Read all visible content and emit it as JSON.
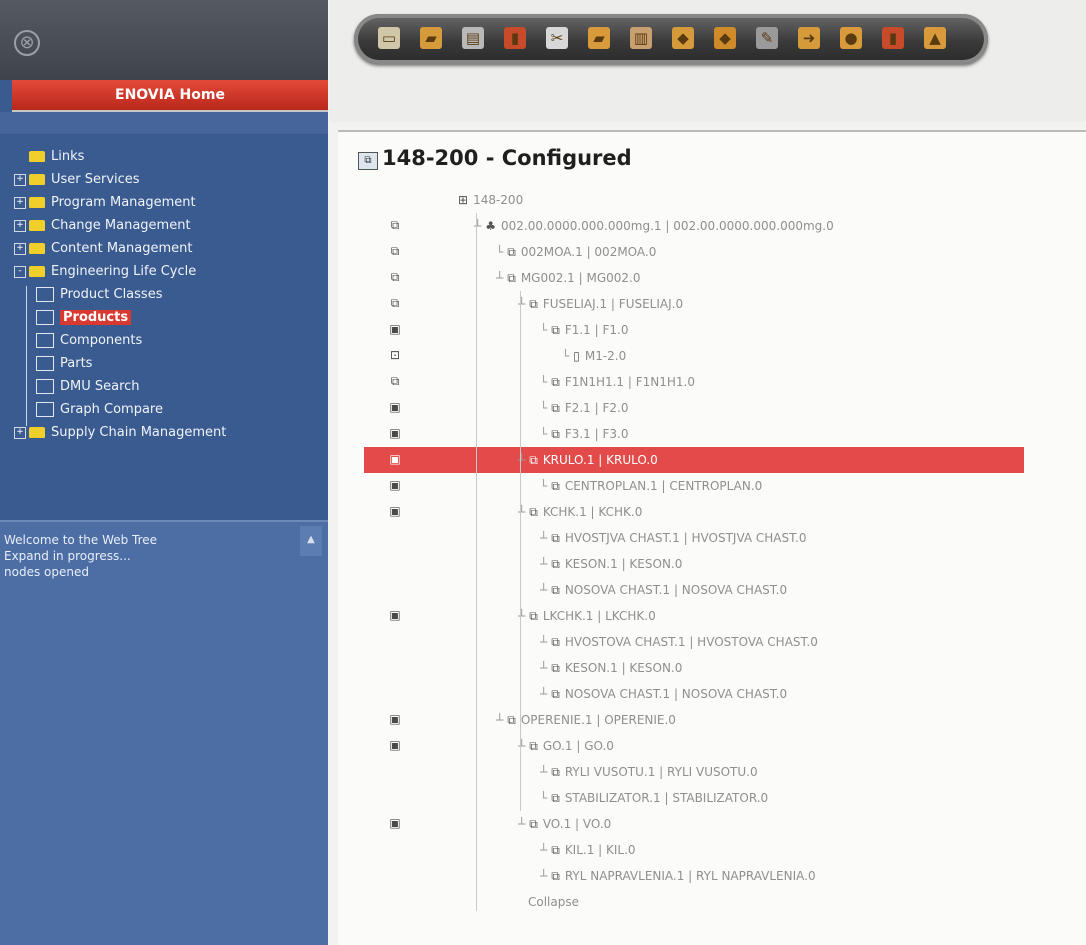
{
  "app": {
    "home_label": "ENOVIA Home"
  },
  "nav": [
    {
      "label": "Links",
      "icon": "folder-icon",
      "expander": "",
      "level": 0
    },
    {
      "label": "User Services",
      "icon": "folder-icon",
      "expander": "+",
      "level": 0
    },
    {
      "label": "Program Management",
      "icon": "folder-icon",
      "expander": "+",
      "level": 0
    },
    {
      "label": "Change Management",
      "icon": "folder-icon",
      "expander": "+",
      "level": 0
    },
    {
      "label": "Content Management",
      "icon": "folder-icon",
      "expander": "+",
      "level": 0
    },
    {
      "label": "Engineering Life Cycle",
      "icon": "folder-icon",
      "expander": "-",
      "level": 0
    },
    {
      "label": "Product Classes",
      "icon": "product-classes-icon",
      "expander": "",
      "level": 1
    },
    {
      "label": "Products",
      "icon": "products-icon",
      "expander": "",
      "level": 1,
      "selected": true
    },
    {
      "label": "Components",
      "icon": "components-icon",
      "expander": "",
      "level": 1
    },
    {
      "label": "Parts",
      "icon": "parts-icon",
      "expander": "",
      "level": 1
    },
    {
      "label": "DMU Search",
      "icon": "dmu-search-icon",
      "expander": "",
      "level": 1
    },
    {
      "label": "Graph Compare",
      "icon": "graph-compare-icon",
      "expander": "",
      "level": 1
    },
    {
      "label": "Supply Chain Management",
      "icon": "folder-icon",
      "expander": "+",
      "level": 0
    }
  ],
  "messages": [
    "Welcome to the Web Tree",
    "Expand in progress...",
    "nodes opened"
  ],
  "toolbar": [
    {
      "name": "new-icon",
      "color": "#cfc7a8"
    },
    {
      "name": "open-folder-icon",
      "color": "#d59a3a"
    },
    {
      "name": "save-icon",
      "color": "#b8b8b8"
    },
    {
      "name": "delete-icon",
      "color": "#c74a2a"
    },
    {
      "name": "cut-icon",
      "color": "#d8d8d8"
    },
    {
      "name": "copy-icon",
      "color": "#d89a3a"
    },
    {
      "name": "paste-icon",
      "color": "#c8a070"
    },
    {
      "name": "expand-icon",
      "color": "#d59a3a"
    },
    {
      "name": "collapse-icon",
      "color": "#cf8a2a"
    },
    {
      "name": "edit-icon",
      "color": "#9a9a9a"
    },
    {
      "name": "forward-icon",
      "color": "#d59a3a"
    },
    {
      "name": "bucket-icon",
      "color": "#d89a3a"
    },
    {
      "name": "doc-export-icon",
      "color": "#c74a2a"
    },
    {
      "name": "lock-icon",
      "color": "#d89a3a"
    }
  ],
  "main": {
    "title": "148-200 - Configured",
    "rows": [
      {
        "text": "148-200",
        "indent": 0,
        "rowicon": "",
        "conn": "",
        "glyph": "⊞"
      },
      {
        "text": "002.00.0000.000.000mg.1 | 002.00.0000.000.000mg.0",
        "indent": 1,
        "rowicon": "⧉",
        "conn": "┴",
        "glyph": "♣"
      },
      {
        "text": "002MOA.1 | 002MOA.0",
        "indent": 2,
        "rowicon": "⧉",
        "conn": "└",
        "glyph": "⧉"
      },
      {
        "text": "MG002.1 | MG002.0",
        "indent": 2,
        "rowicon": "⧉",
        "conn": "┴",
        "glyph": "⧉"
      },
      {
        "text": "FUSELIAJ.1 | FUSELIAJ.0",
        "indent": 3,
        "rowicon": "⧉",
        "conn": "┴",
        "glyph": "⧉"
      },
      {
        "text": "F1.1 | F1.0",
        "indent": 4,
        "rowicon": "▣",
        "conn": "└",
        "glyph": "⧉"
      },
      {
        "text": "M1-2.0",
        "indent": 5,
        "rowicon": "⊡",
        "conn": "└",
        "glyph": "▯"
      },
      {
        "text": "F1N1H1.1 | F1N1H1.0",
        "indent": 4,
        "rowicon": "⧉",
        "conn": "└",
        "glyph": "⧉"
      },
      {
        "text": "F2.1 | F2.0",
        "indent": 4,
        "rowicon": "▣",
        "conn": "└",
        "glyph": "⧉"
      },
      {
        "text": "F3.1 | F3.0",
        "indent": 4,
        "rowicon": "▣",
        "conn": "└",
        "glyph": "⧉"
      },
      {
        "text": "KRULO.1 | KRULO.0",
        "indent": 3,
        "rowicon": "▣",
        "conn": "┴",
        "glyph": "⧉",
        "selected": true
      },
      {
        "text": "CENTROPLAN.1 | CENTROPLAN.0",
        "indent": 4,
        "rowicon": "▣",
        "conn": "└",
        "glyph": "⧉"
      },
      {
        "text": "KCHK.1 | KCHK.0",
        "indent": 3,
        "rowicon": "▣",
        "conn": "┴",
        "glyph": "⧉"
      },
      {
        "text": "HVOSTJVA CHAST.1 | HVOSTJVA CHAST.0",
        "indent": 4,
        "rowicon": "",
        "conn": "┴",
        "glyph": "⧉"
      },
      {
        "text": "KESON.1 | KESON.0",
        "indent": 4,
        "rowicon": "",
        "conn": "┴",
        "glyph": "⧉"
      },
      {
        "text": "NOSOVA CHAST.1 | NOSOVA CHAST.0",
        "indent": 4,
        "rowicon": "",
        "conn": "┴",
        "glyph": "⧉"
      },
      {
        "text": "LKCHK.1 | LKCHK.0",
        "indent": 3,
        "rowicon": "▣",
        "conn": "┴",
        "glyph": "⧉"
      },
      {
        "text": "HVOSTOVA CHAST.1 | HVOSTOVA CHAST.0",
        "indent": 4,
        "rowicon": "",
        "conn": "┴",
        "glyph": "⧉"
      },
      {
        "text": "KESON.1 | KESON.0",
        "indent": 4,
        "rowicon": "",
        "conn": "┴",
        "glyph": "⧉"
      },
      {
        "text": "NOSOVA CHAST.1 | NOSOVA CHAST.0",
        "indent": 4,
        "rowicon": "",
        "conn": "┴",
        "glyph": "⧉"
      },
      {
        "text": "OPERENIE.1 | OPERENIE.0",
        "indent": 2,
        "rowicon": "▣",
        "conn": "┴",
        "glyph": "⧉"
      },
      {
        "text": "GO.1 | GO.0",
        "indent": 3,
        "rowicon": "▣",
        "conn": "┴",
        "glyph": "⧉"
      },
      {
        "text": "RYLI VUSOTU.1 | RYLI VUSOTU.0",
        "indent": 4,
        "rowicon": "",
        "conn": "┴",
        "glyph": "⧉"
      },
      {
        "text": "STABILIZATOR.1 | STABILIZATOR.0",
        "indent": 4,
        "rowicon": "",
        "conn": "└",
        "glyph": "⧉"
      },
      {
        "text": "VO.1 | VO.0",
        "indent": 3,
        "rowicon": "▣",
        "conn": "┴",
        "glyph": "⧉"
      },
      {
        "text": "KIL.1 | KIL.0",
        "indent": 4,
        "rowicon": "",
        "conn": "┴",
        "glyph": "⧉"
      },
      {
        "text": "RYL NAPRAVLENIA.1 | RYL NAPRAVLENIA.0",
        "indent": 4,
        "rowicon": "",
        "conn": "┴",
        "glyph": "⧉"
      },
      {
        "text": "Collapse",
        "indent": 1,
        "rowicon": "",
        "conn": "",
        "glyph": ""
      }
    ]
  }
}
